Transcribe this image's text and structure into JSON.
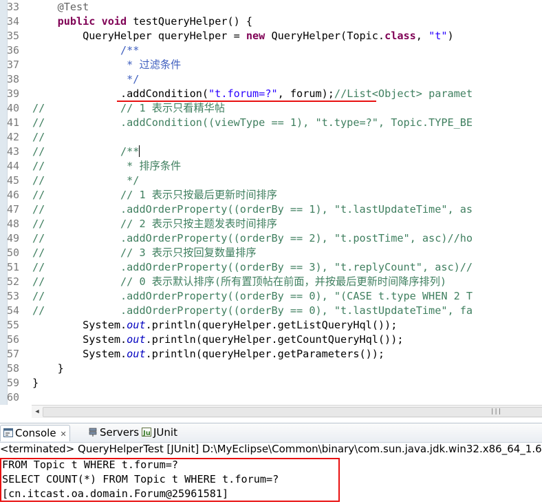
{
  "editor": {
    "lines": [
      {
        "num": "33",
        "tokens": [
          {
            "t": "    "
          },
          {
            "t": "@Test",
            "c": "ann"
          }
        ]
      },
      {
        "num": "34",
        "tokens": [
          {
            "t": "    "
          },
          {
            "t": "public",
            "c": "kw"
          },
          {
            "t": " "
          },
          {
            "t": "void",
            "c": "kw"
          },
          {
            "t": " testQueryHelper() {"
          }
        ]
      },
      {
        "num": "35",
        "tokens": [
          {
            "t": "        QueryHelper queryHelper = "
          },
          {
            "t": "new",
            "c": "kw"
          },
          {
            "t": " QueryHelper(Topic."
          },
          {
            "t": "class",
            "c": "kw"
          },
          {
            "t": ", "
          },
          {
            "t": "\"t\"",
            "c": "str"
          },
          {
            "t": ")"
          }
        ]
      },
      {
        "num": "36",
        "tokens": [
          {
            "t": "              "
          },
          {
            "t": "/**",
            "c": "doc"
          }
        ]
      },
      {
        "num": "37",
        "tokens": [
          {
            "t": "               "
          },
          {
            "t": "* 过滤条件",
            "c": "doc"
          }
        ]
      },
      {
        "num": "38",
        "tokens": [
          {
            "t": "               "
          },
          {
            "t": "*/",
            "c": "doc"
          }
        ]
      },
      {
        "num": "39",
        "tokens": [
          {
            "t": "              .addCondition("
          },
          {
            "t": "\"t.forum=?\"",
            "c": "str"
          },
          {
            "t": ", forum);"
          },
          {
            "t": "//List<Object> paramet",
            "c": "cmt"
          }
        ]
      },
      {
        "num": "40",
        "tokens": [
          {
            "t": "//            // 1 表示只看精华帖",
            "c": "cmt"
          }
        ]
      },
      {
        "num": "41",
        "tokens": [
          {
            "t": "//            .addCondition((viewType == 1), \"t.type=?\", Topic.TYPE_BE",
            "c": "cmt"
          }
        ]
      },
      {
        "num": "42",
        "tokens": [
          {
            "t": "//",
            "c": "cmt"
          }
        ]
      },
      {
        "num": "43",
        "tokens": [
          {
            "t": "//            /**",
            "c": "cmt"
          },
          {
            "cursor": true
          }
        ]
      },
      {
        "num": "44",
        "tokens": [
          {
            "t": "//             * 排序条件",
            "c": "cmt"
          }
        ]
      },
      {
        "num": "45",
        "tokens": [
          {
            "t": "//             */",
            "c": "cmt"
          }
        ]
      },
      {
        "num": "46",
        "tokens": [
          {
            "t": "//            // 1 表示只按最后更新时间排序",
            "c": "cmt"
          }
        ]
      },
      {
        "num": "47",
        "tokens": [
          {
            "t": "//            .addOrderProperty((orderBy == 1), \"t.lastUpdateTime\", as",
            "c": "cmt"
          }
        ]
      },
      {
        "num": "48",
        "tokens": [
          {
            "t": "//            // 2 表示只按主题发表时间排序",
            "c": "cmt"
          }
        ]
      },
      {
        "num": "49",
        "tokens": [
          {
            "t": "//            .addOrderProperty((orderBy == 2), \"t.postTime\", asc)//ho",
            "c": "cmt"
          }
        ]
      },
      {
        "num": "50",
        "tokens": [
          {
            "t": "//            // 3 表示只按回复数量排序",
            "c": "cmt"
          }
        ]
      },
      {
        "num": "51",
        "tokens": [
          {
            "t": "//            .addOrderProperty((orderBy == 3), \"t.replyCount\", asc)//",
            "c": "cmt"
          }
        ]
      },
      {
        "num": "52",
        "tokens": [
          {
            "t": "//            // 0 表示默认排序(所有置顶帖在前面，并按最后更新时间降序排列)",
            "c": "cmt"
          }
        ]
      },
      {
        "num": "53",
        "tokens": [
          {
            "t": "//            .addOrderProperty((orderBy == 0), \"(CASE t.type WHEN 2 T",
            "c": "cmt"
          }
        ]
      },
      {
        "num": "54",
        "tokens": [
          {
            "t": "//            .addOrderProperty((orderBy == 0), \"t.lastUpdateTime\", fa",
            "c": "cmt"
          }
        ]
      },
      {
        "num": "55",
        "tokens": [
          {
            "t": "        System."
          },
          {
            "t": "out",
            "c": "fld"
          },
          {
            "t": ".println(queryHelper.getListQueryHql());"
          }
        ]
      },
      {
        "num": "56",
        "tokens": [
          {
            "t": "        System."
          },
          {
            "t": "out",
            "c": "fld"
          },
          {
            "t": ".println(queryHelper.getCountQueryHql());"
          }
        ]
      },
      {
        "num": "57",
        "tokens": [
          {
            "t": "        System."
          },
          {
            "t": "out",
            "c": "fld"
          },
          {
            "t": ".println(queryHelper.getParameters());"
          }
        ]
      },
      {
        "num": "58",
        "tokens": [
          {
            "t": "    }"
          }
        ]
      },
      {
        "num": "59",
        "tokens": [
          {
            "t": "}"
          }
        ]
      },
      {
        "num": "60",
        "tokens": []
      }
    ]
  },
  "tabs": {
    "console": "Console",
    "console_close": "✕",
    "servers": "Servers",
    "junit": "JUnit"
  },
  "status_line": "<terminated> QueryHelperTest [JUnit] D:\\MyEclipse\\Common\\binary\\com.sun.java.jdk.win32.x86_64_1.6",
  "console_output": [
    "FROM Topic t WHERE t.forum=?",
    "SELECT COUNT(*) FROM Topic t WHERE t.forum=?",
    "[cn.itcast.oa.domain.Forum@25961581]"
  ],
  "colors": {
    "keyword": "#7f0055",
    "comment": "#3f7f5f",
    "javadoc": "#3f5fbf",
    "string": "#2a00ff",
    "field": "#0000c0",
    "highlight": "#e81010"
  },
  "icons": [
    "console-icon",
    "servers-icon",
    "junit-icon",
    "close-icon"
  ]
}
